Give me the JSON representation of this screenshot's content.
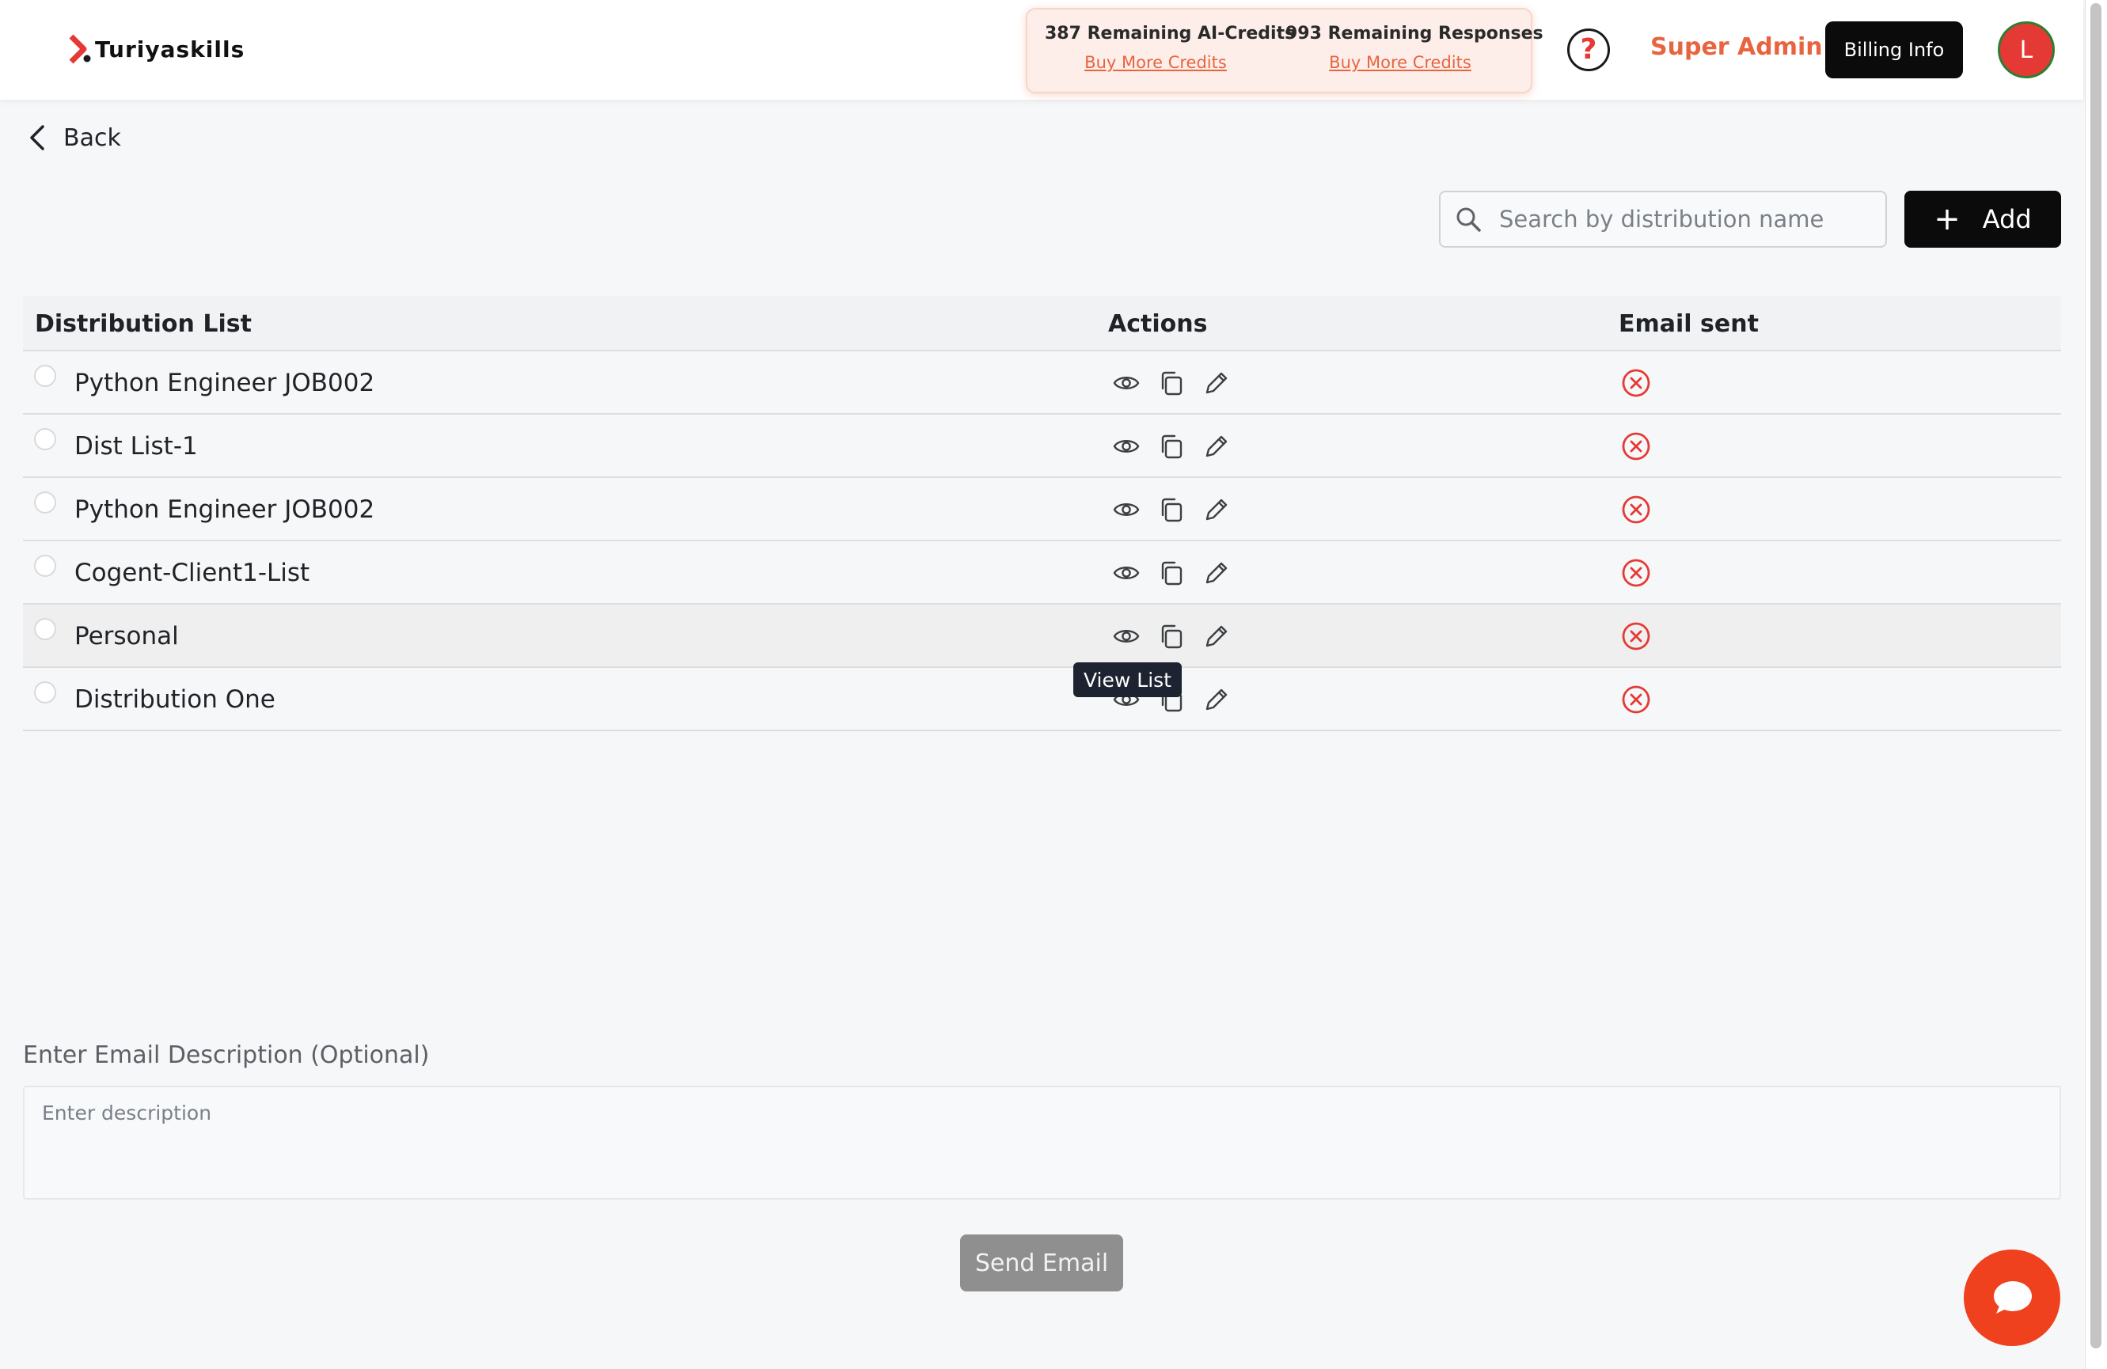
{
  "header": {
    "logo_text": "Turiyaskills",
    "credits": [
      {
        "text": "387 Remaining AI-Credits",
        "link": "Buy More Credits"
      },
      {
        "text": "993 Remaining Responses",
        "link": "Buy More Credits"
      }
    ],
    "role": "Super Admin",
    "billing_label": "Billing Info",
    "avatar_initial": "L"
  },
  "back_label": "Back",
  "search": {
    "placeholder": "Search by distribution name"
  },
  "add_label": "Add",
  "table": {
    "headers": [
      "Distribution List",
      "Actions",
      "Email sent"
    ],
    "rows": [
      {
        "name": "Python Engineer JOB002",
        "email_sent": false
      },
      {
        "name": "Dist List-1",
        "email_sent": false
      },
      {
        "name": "Python Engineer JOB002",
        "email_sent": false
      },
      {
        "name": "Cogent-Client1-List",
        "email_sent": false
      },
      {
        "name": "Personal",
        "email_sent": false
      },
      {
        "name": "Distribution One",
        "email_sent": false
      }
    ]
  },
  "tooltip": "View List",
  "description": {
    "label": "Enter Email Description (Optional)",
    "placeholder": "Enter description"
  },
  "send_label": "Send Email",
  "colors": {
    "accent": "#e8643f",
    "status_not_sent": "#e53935",
    "chat_button": "#f0411f"
  }
}
